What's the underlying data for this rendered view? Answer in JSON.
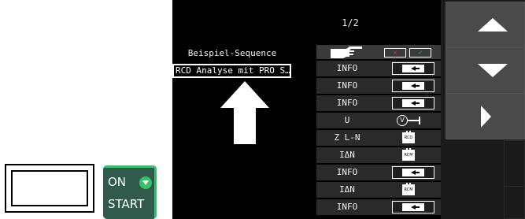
{
  "screen": {
    "page_indicator": "1/2",
    "sequence_title": "Beispiel-Sequence",
    "sequence_selected": "RCD Analyse mit PRO S…",
    "steps": [
      {
        "label": "INFO",
        "icon": "enter-arrow-icon"
      },
      {
        "label": "INFO",
        "icon": "enter-arrow-icon"
      },
      {
        "label": "INFO",
        "icon": "enter-arrow-icon"
      },
      {
        "label": "U",
        "icon": "voltage-probe-icon",
        "icon_text": "V"
      },
      {
        "label": "Z L-N",
        "icon": "rcd-chip-icon",
        "icon_text": "RCD"
      },
      {
        "label": "IΔN",
        "icon": "rcm-chip-icon",
        "icon_text": "RCM"
      },
      {
        "label": "INFO",
        "icon": "enter-arrow-icon"
      },
      {
        "label": "IΔN",
        "icon": "rcm-chip-icon",
        "icon_text": "RCM"
      },
      {
        "label": "INFO",
        "icon": "enter-arrow-icon"
      }
    ],
    "header_cancel_symbol": "✕",
    "header_ok_symbol": "✓"
  },
  "side_keys": {
    "up": "arrow-up-icon",
    "down": "arrow-down-icon",
    "right": "arrow-right-icon"
  },
  "device": {
    "start_on": "ON",
    "start_label": "START"
  },
  "colors": {
    "screen_bg": "#000000",
    "row_bg": "#2a2a2a",
    "softkey_bg": "#4a4a4a",
    "start_green": "#39c06a",
    "cancel_red": "#e03030",
    "ok_green": "#33c653"
  }
}
